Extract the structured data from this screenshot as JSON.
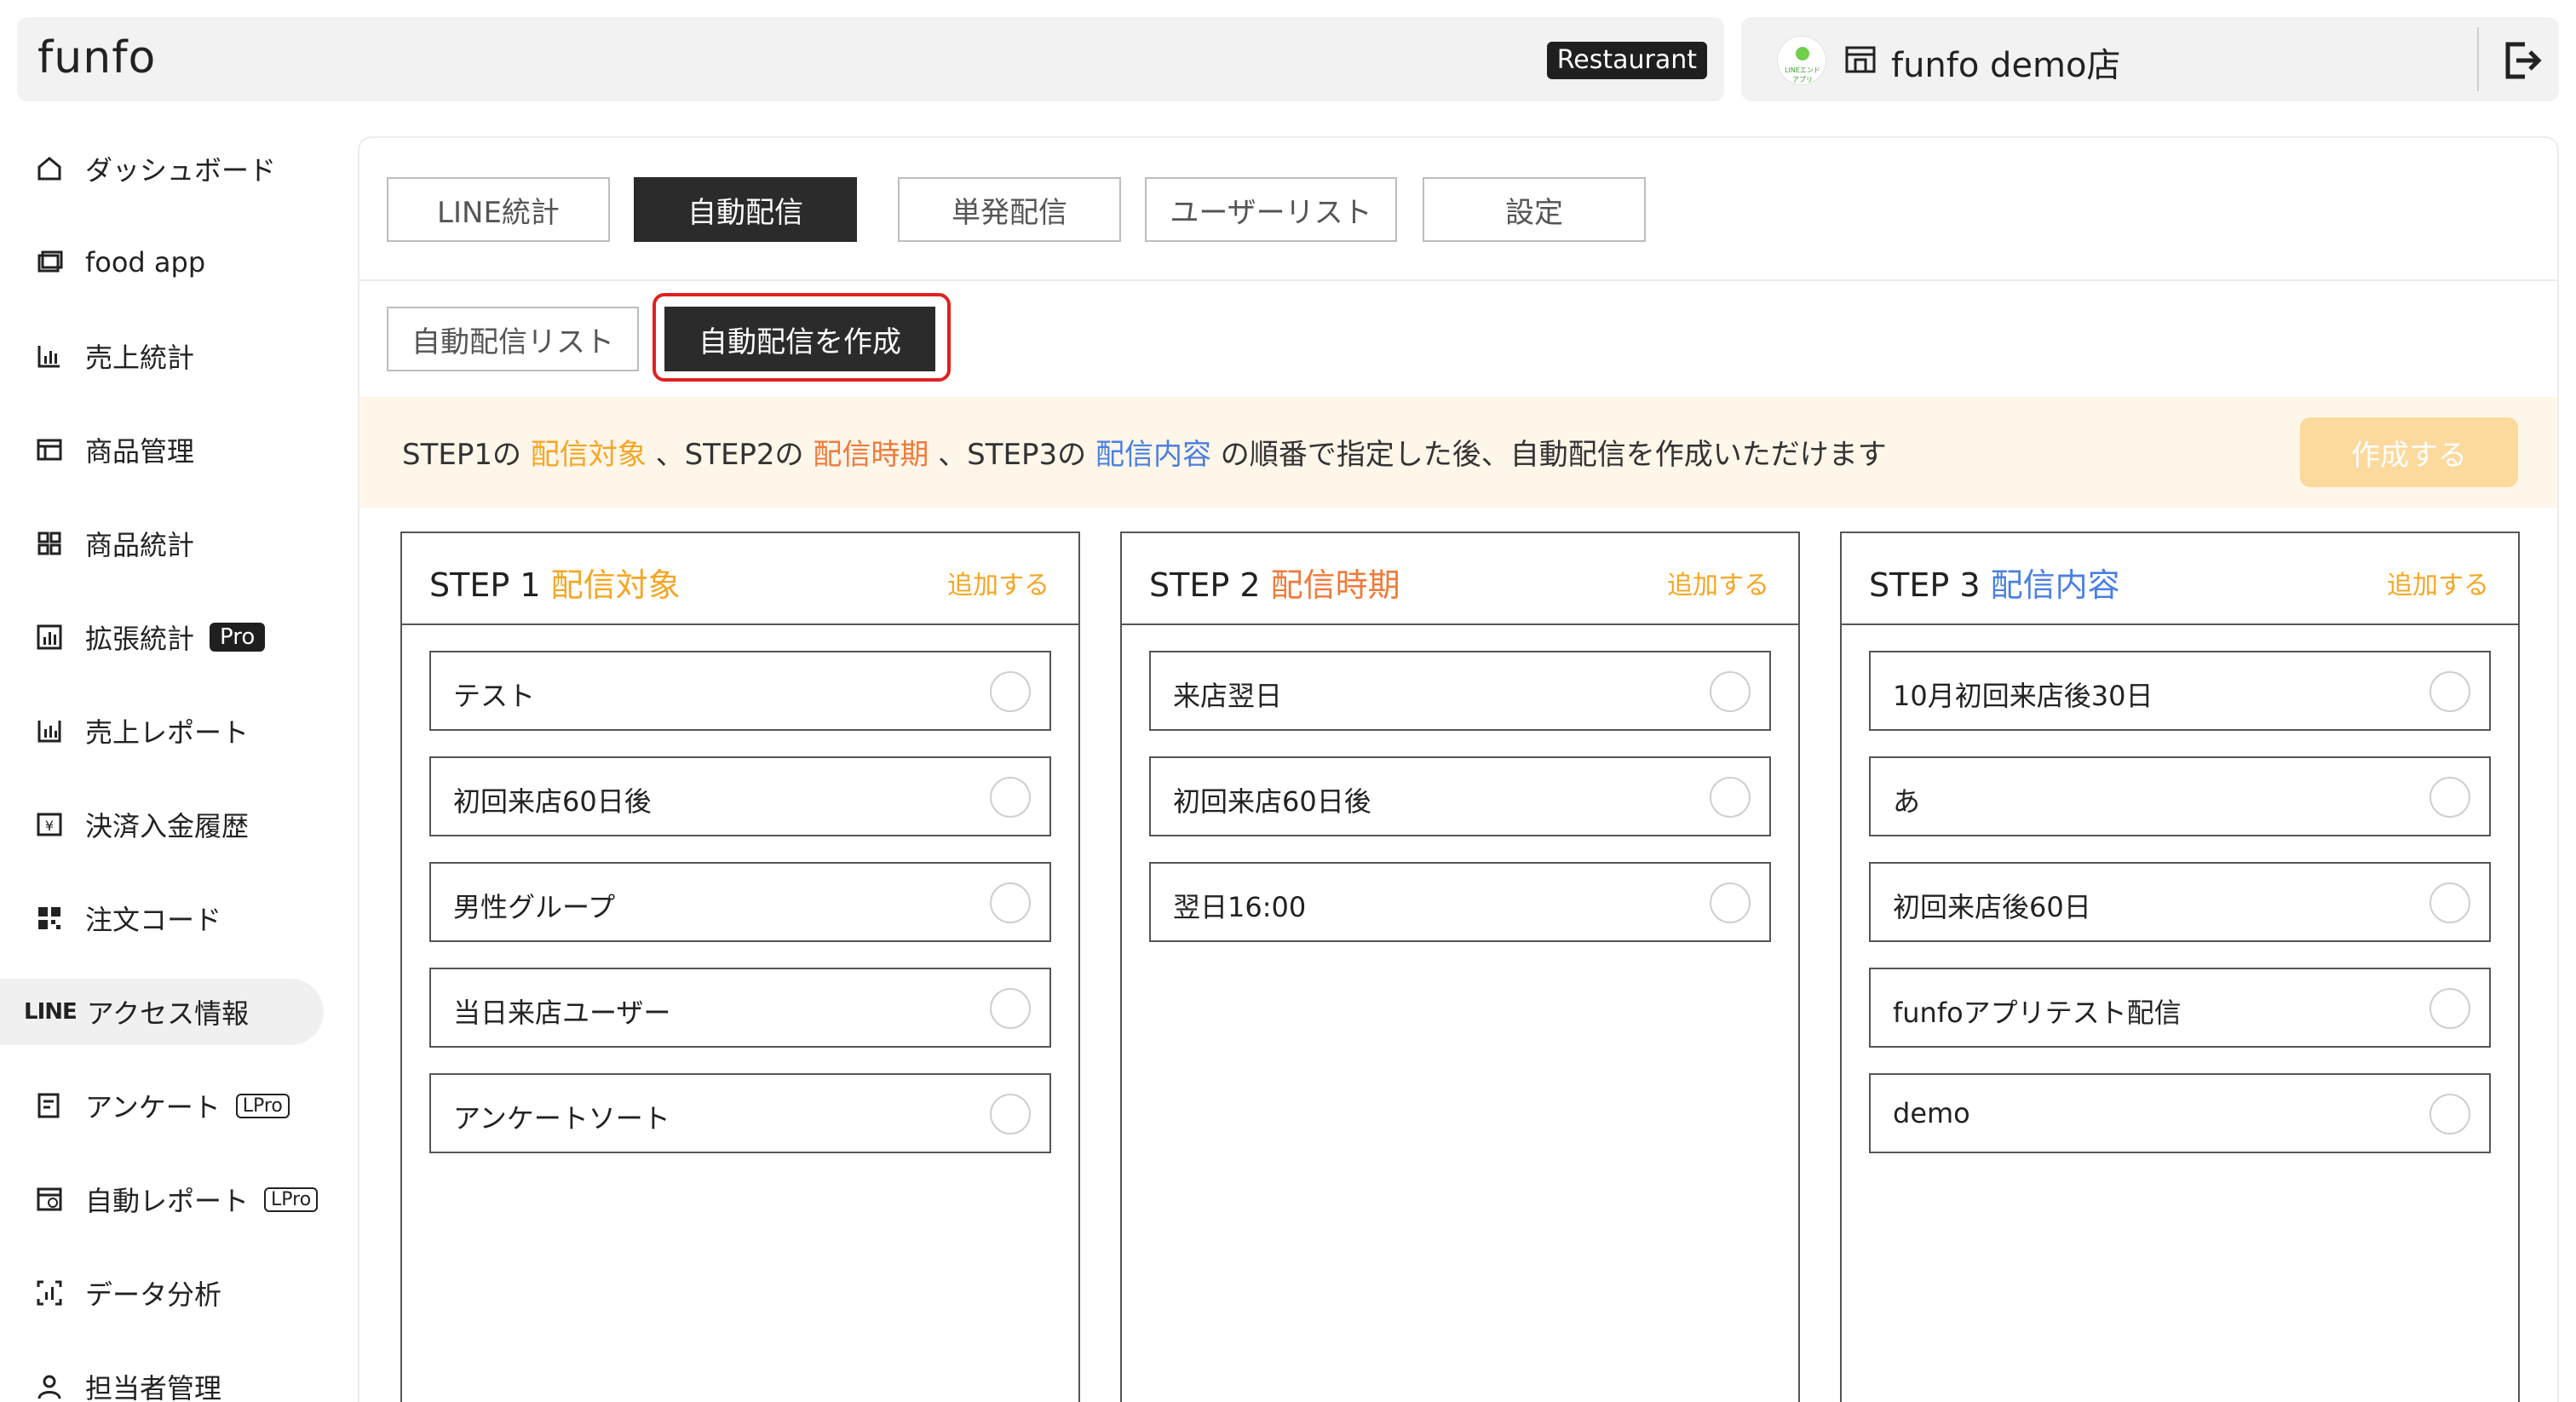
{
  "header": {
    "logo": "funfo",
    "restaurant_badge": "Restaurant",
    "shop_avatar_text": "LINEエンドアプリ",
    "shop_name": "funfo demo店"
  },
  "sidebar": {
    "items": [
      {
        "label": "ダッシュボード",
        "icon": "home-icon"
      },
      {
        "label": "food app",
        "icon": "app-icon"
      },
      {
        "label": "売上統計",
        "icon": "bar-chart-icon"
      },
      {
        "label": "商品管理",
        "icon": "table-icon"
      },
      {
        "label": "商品統計",
        "icon": "grid-icon"
      },
      {
        "label": "拡張統計",
        "icon": "chart-box-icon",
        "tag": "Pro"
      },
      {
        "label": "売上レポート",
        "icon": "report-icon"
      },
      {
        "label": "決済入金履歴",
        "icon": "receipt-icon"
      },
      {
        "label": "注文コード",
        "icon": "qr-icon"
      },
      {
        "label": "アクセス情報",
        "icon": "line-icon",
        "prefix": "LINE"
      },
      {
        "label": "アンケート",
        "icon": "survey-icon",
        "tag": "LPro"
      },
      {
        "label": "自動レポート",
        "icon": "auto-report-icon",
        "tag": "LPro"
      },
      {
        "label": "データ分析",
        "icon": "analysis-icon"
      },
      {
        "label": "担当者管理",
        "icon": "user-icon"
      }
    ]
  },
  "tabs": [
    "LINE統計",
    "自動配信",
    "単発配信",
    "ユーザーリスト",
    "設定"
  ],
  "subtabs": [
    "自動配信リスト",
    "自動配信を作成"
  ],
  "notice": {
    "p1": "STEP1の ",
    "k1": "配信対象",
    "p2": " 、STEP2の ",
    "k2": "配信時期",
    "p3": " 、STEP3の ",
    "k3": "配信内容",
    "p4": " の順番で指定した後、自動配信を作成いただけます",
    "create_button": "作成する"
  },
  "steps": [
    {
      "step": "STEP 1",
      "title": "配信対象",
      "add": "追加する",
      "options": [
        "テスト",
        "初回来店60日後",
        "男性グループ",
        "当日来店ユーザー",
        "アンケートソート"
      ]
    },
    {
      "step": "STEP 2",
      "title": "配信時期",
      "add": "追加する",
      "options": [
        "来店翌日",
        "初回来店60日後",
        "翌日16:00"
      ]
    },
    {
      "step": "STEP 3",
      "title": "配信内容",
      "add": "追加する",
      "options": [
        "10月初回来店後30日",
        "あ",
        "初回来店後60日",
        "funfoアプリテスト配信",
        "demo"
      ]
    }
  ],
  "colors": {
    "accent_orange": "#f5a623",
    "accent_red_orange": "#f07a3a",
    "accent_blue": "#4a7fe0",
    "dark": "#2b2b2b",
    "highlight_red": "#e02020",
    "notice_bg": "#fff6ea"
  }
}
